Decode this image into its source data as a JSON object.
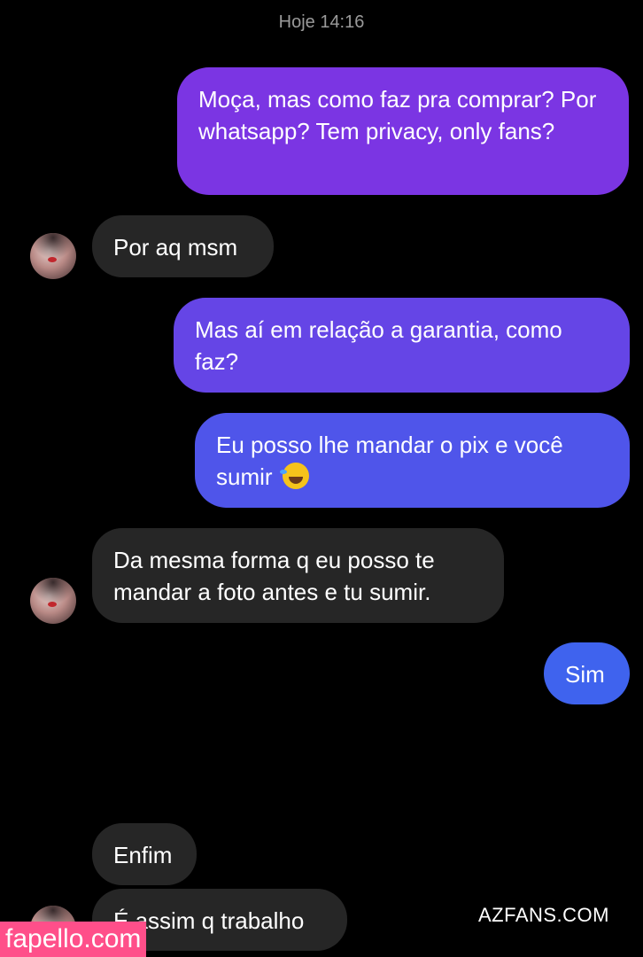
{
  "header": {
    "timestamp": "Hoje 14:16"
  },
  "messages": [
    {
      "direction": "sent",
      "text": "Moça, mas como faz pra comprar? Por whatsapp? Tem privacy, only fans?"
    },
    {
      "direction": "received",
      "text": "Por aq msm"
    },
    {
      "direction": "sent",
      "text": "Mas aí em relação a garantia, como faz?"
    },
    {
      "direction": "sent",
      "text": "Eu posso lhe mandar o pix e você sumir",
      "emoji": "rolling-on-floor-laughing"
    },
    {
      "direction": "received",
      "text": "Da mesma forma q eu posso te mandar a foto antes e tu sumir."
    },
    {
      "direction": "sent",
      "text": "Sim"
    },
    {
      "direction": "received",
      "text": "Enfim"
    },
    {
      "direction": "received",
      "text": "É assim q trabalho"
    }
  ],
  "watermarks": {
    "azfans": "AZFANS.COM",
    "fapello": "fapello.com"
  },
  "colors": {
    "sent_top": "#7b35e3",
    "sent_bottom": "#3f63ee",
    "received": "#262626",
    "background": "#000000"
  }
}
